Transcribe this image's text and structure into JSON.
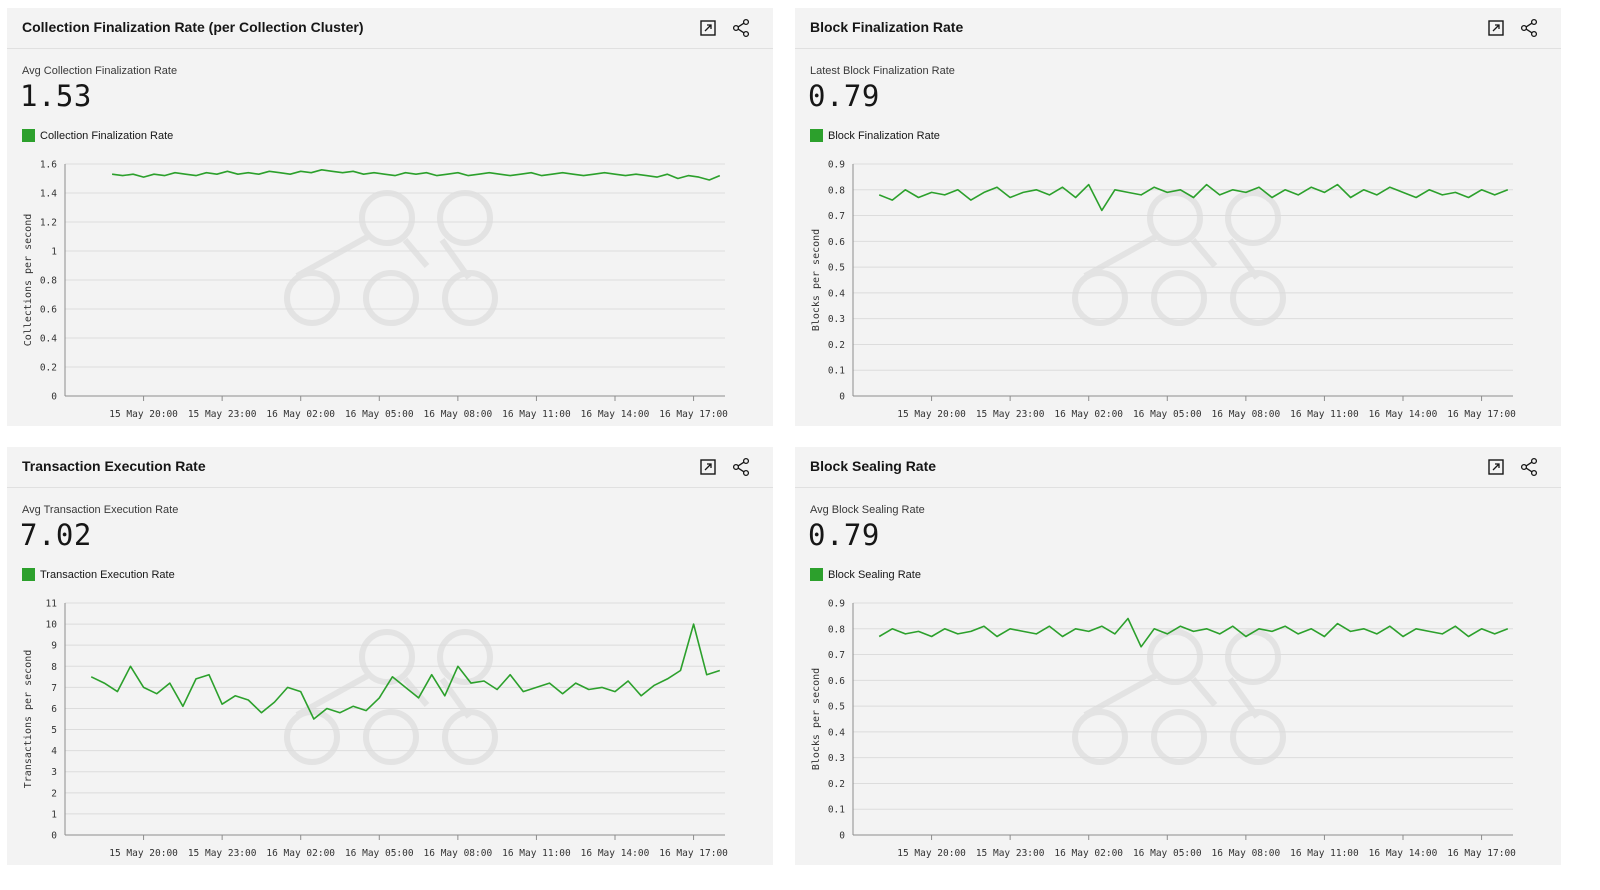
{
  "panels": [
    {
      "title": "Collection Finalization Rate (per Collection Cluster)",
      "metric_label": "Avg Collection Finalization Rate",
      "metric_value": "1.53",
      "legend_label": "Collection Finalization Rate",
      "expand_icon": "expand-icon",
      "share_icon": "share-icon"
    },
    {
      "title": "Block Finalization Rate",
      "metric_label": "Latest Block Finalization Rate",
      "metric_value": "0.79",
      "legend_label": "Block Finalization Rate",
      "expand_icon": "expand-icon",
      "share_icon": "share-icon"
    },
    {
      "title": "Transaction Execution Rate",
      "metric_label": "Avg Transaction Execution Rate",
      "metric_value": "7.02",
      "legend_label": "Transaction Execution Rate",
      "expand_icon": "expand-icon",
      "share_icon": "share-icon"
    },
    {
      "title": "Block Sealing Rate",
      "metric_label": "Avg Block Sealing Rate",
      "metric_value": "0.79",
      "legend_label": "Block Sealing Rate",
      "expand_icon": "expand-icon",
      "share_icon": "share-icon"
    }
  ],
  "colors": {
    "series": "#2ca02c",
    "panel_bg": "#f3f3f3",
    "grid": "#dcdcdc",
    "watermark": "#e3e3e3"
  },
  "chart_data": [
    {
      "type": "line",
      "ylabel": "Collections per second",
      "ylim": [
        0,
        1.6
      ],
      "yticks": [
        "0",
        "0.2",
        "0.4",
        "0.6",
        "0.8",
        "1",
        "1.2",
        "1.4",
        "1.6"
      ],
      "xticks": [
        "15 May 20:00",
        "15 May 23:00",
        "16 May 02:00",
        "16 May 05:00",
        "16 May 08:00",
        "16 May 11:00",
        "16 May 14:00",
        "16 May 17:00"
      ],
      "grid": true,
      "series": [
        {
          "name": "Collection Finalization Rate",
          "x": [
            18.8,
            19.2,
            19.6,
            20.0,
            20.4,
            20.8,
            21.2,
            21.6,
            22.0,
            22.4,
            22.8,
            23.2,
            23.6,
            24.0,
            24.4,
            24.8,
            25.2,
            25.6,
            26.0,
            26.4,
            26.8,
            27.2,
            27.6,
            28.0,
            28.4,
            28.8,
            29.2,
            29.6,
            30.0,
            30.4,
            30.8,
            31.2,
            31.6,
            32.0,
            32.4,
            32.8,
            33.2,
            33.6,
            34.0,
            34.4,
            34.8,
            35.2,
            35.6,
            36.0,
            36.4,
            36.8,
            37.2,
            37.6,
            38.0,
            38.4,
            38.8,
            39.2,
            39.6,
            40.0,
            40.4,
            40.8,
            41.2,
            41.6,
            42.0
          ],
          "values": [
            1.53,
            1.52,
            1.53,
            1.51,
            1.53,
            1.52,
            1.54,
            1.53,
            1.52,
            1.54,
            1.53,
            1.55,
            1.53,
            1.54,
            1.53,
            1.55,
            1.54,
            1.53,
            1.55,
            1.54,
            1.56,
            1.55,
            1.54,
            1.55,
            1.53,
            1.54,
            1.53,
            1.52,
            1.54,
            1.53,
            1.54,
            1.52,
            1.53,
            1.54,
            1.52,
            1.53,
            1.54,
            1.53,
            1.52,
            1.53,
            1.54,
            1.52,
            1.53,
            1.54,
            1.53,
            1.52,
            1.53,
            1.54,
            1.53,
            1.52,
            1.53,
            1.52,
            1.51,
            1.53,
            1.5,
            1.52,
            1.51,
            1.49,
            1.52
          ]
        }
      ]
    },
    {
      "type": "line",
      "ylabel": "Blocks per second",
      "ylim": [
        0,
        0.9
      ],
      "yticks": [
        "0",
        "0.1",
        "0.2",
        "0.3",
        "0.4",
        "0.5",
        "0.6",
        "0.7",
        "0.8",
        "0.9"
      ],
      "xticks": [
        "15 May 20:00",
        "15 May 23:00",
        "16 May 02:00",
        "16 May 05:00",
        "16 May 08:00",
        "16 May 11:00",
        "16 May 14:00",
        "16 May 17:00"
      ],
      "grid": true,
      "series": [
        {
          "name": "Block Finalization Rate",
          "x": [
            18.0,
            18.5,
            19.0,
            19.5,
            20.0,
            20.5,
            21.0,
            21.5,
            22.0,
            22.5,
            23.0,
            23.5,
            24.0,
            24.5,
            25.0,
            25.5,
            26.0,
            26.5,
            27.0,
            27.5,
            28.0,
            28.5,
            29.0,
            29.5,
            30.0,
            30.5,
            31.0,
            31.5,
            32.0,
            32.5,
            33.0,
            33.5,
            34.0,
            34.5,
            35.0,
            35.5,
            36.0,
            36.5,
            37.0,
            37.5,
            38.0,
            38.5,
            39.0,
            39.5,
            40.0,
            40.5,
            41.0,
            41.5,
            42.0
          ],
          "values": [
            0.78,
            0.76,
            0.8,
            0.77,
            0.79,
            0.78,
            0.8,
            0.76,
            0.79,
            0.81,
            0.77,
            0.79,
            0.8,
            0.78,
            0.81,
            0.77,
            0.82,
            0.72,
            0.8,
            0.79,
            0.78,
            0.81,
            0.79,
            0.8,
            0.77,
            0.82,
            0.78,
            0.8,
            0.79,
            0.81,
            0.77,
            0.8,
            0.78,
            0.81,
            0.79,
            0.82,
            0.77,
            0.8,
            0.78,
            0.81,
            0.79,
            0.77,
            0.8,
            0.78,
            0.79,
            0.77,
            0.8,
            0.78,
            0.8
          ]
        }
      ]
    },
    {
      "type": "line",
      "ylabel": "Transactions per second",
      "ylim": [
        0,
        11
      ],
      "yticks": [
        "0",
        "1",
        "2",
        "3",
        "4",
        "5",
        "6",
        "7",
        "8",
        "9",
        "10",
        "11"
      ],
      "xticks": [
        "15 May 20:00",
        "15 May 23:00",
        "16 May 02:00",
        "16 May 05:00",
        "16 May 08:00",
        "16 May 11:00",
        "16 May 14:00",
        "16 May 17:00"
      ],
      "grid": true,
      "series": [
        {
          "name": "Transaction Execution Rate",
          "x": [
            18.0,
            18.5,
            19.0,
            19.5,
            20.0,
            20.5,
            21.0,
            21.5,
            22.0,
            22.5,
            23.0,
            23.5,
            24.0,
            24.5,
            25.0,
            25.5,
            26.0,
            26.5,
            27.0,
            27.5,
            28.0,
            28.5,
            29.0,
            29.5,
            30.0,
            30.5,
            31.0,
            31.5,
            32.0,
            32.5,
            33.0,
            33.5,
            34.0,
            34.5,
            35.0,
            35.5,
            36.0,
            36.5,
            37.0,
            37.5,
            38.0,
            38.5,
            39.0,
            39.5,
            40.0,
            40.5,
            41.0,
            41.5,
            42.0
          ],
          "values": [
            7.5,
            7.2,
            6.8,
            8.0,
            7.0,
            6.7,
            7.2,
            6.1,
            7.4,
            7.6,
            6.2,
            6.6,
            6.4,
            5.8,
            6.3,
            7.0,
            6.8,
            5.5,
            6.0,
            5.8,
            6.1,
            5.9,
            6.5,
            7.5,
            7.0,
            6.5,
            7.6,
            6.6,
            8.0,
            7.2,
            7.3,
            6.9,
            7.6,
            6.8,
            7.0,
            7.2,
            6.7,
            7.2,
            6.9,
            7.0,
            6.8,
            7.3,
            6.6,
            7.1,
            7.4,
            7.8,
            10.0,
            7.6,
            7.8
          ]
        }
      ]
    },
    {
      "type": "line",
      "ylabel": "Blocks per second",
      "ylim": [
        0,
        0.9
      ],
      "yticks": [
        "0",
        "0.1",
        "0.2",
        "0.3",
        "0.4",
        "0.5",
        "0.6",
        "0.7",
        "0.8",
        "0.9"
      ],
      "xticks": [
        "15 May 20:00",
        "15 May 23:00",
        "16 May 02:00",
        "16 May 05:00",
        "16 May 08:00",
        "16 May 11:00",
        "16 May 14:00",
        "16 May 17:00"
      ],
      "grid": true,
      "series": [
        {
          "name": "Block Sealing Rate",
          "x": [
            18.0,
            18.5,
            19.0,
            19.5,
            20.0,
            20.5,
            21.0,
            21.5,
            22.0,
            22.5,
            23.0,
            23.5,
            24.0,
            24.5,
            25.0,
            25.5,
            26.0,
            26.5,
            27.0,
            27.5,
            28.0,
            28.5,
            29.0,
            29.5,
            30.0,
            30.5,
            31.0,
            31.5,
            32.0,
            32.5,
            33.0,
            33.5,
            34.0,
            34.5,
            35.0,
            35.5,
            36.0,
            36.5,
            37.0,
            37.5,
            38.0,
            38.5,
            39.0,
            39.5,
            40.0,
            40.5,
            41.0,
            41.5,
            42.0
          ],
          "values": [
            0.77,
            0.8,
            0.78,
            0.79,
            0.77,
            0.8,
            0.78,
            0.79,
            0.81,
            0.77,
            0.8,
            0.79,
            0.78,
            0.81,
            0.77,
            0.8,
            0.79,
            0.81,
            0.78,
            0.84,
            0.73,
            0.8,
            0.78,
            0.81,
            0.79,
            0.8,
            0.78,
            0.81,
            0.77,
            0.8,
            0.79,
            0.81,
            0.78,
            0.8,
            0.77,
            0.82,
            0.79,
            0.8,
            0.78,
            0.81,
            0.77,
            0.8,
            0.79,
            0.78,
            0.81,
            0.77,
            0.8,
            0.78,
            0.8
          ]
        }
      ]
    }
  ]
}
